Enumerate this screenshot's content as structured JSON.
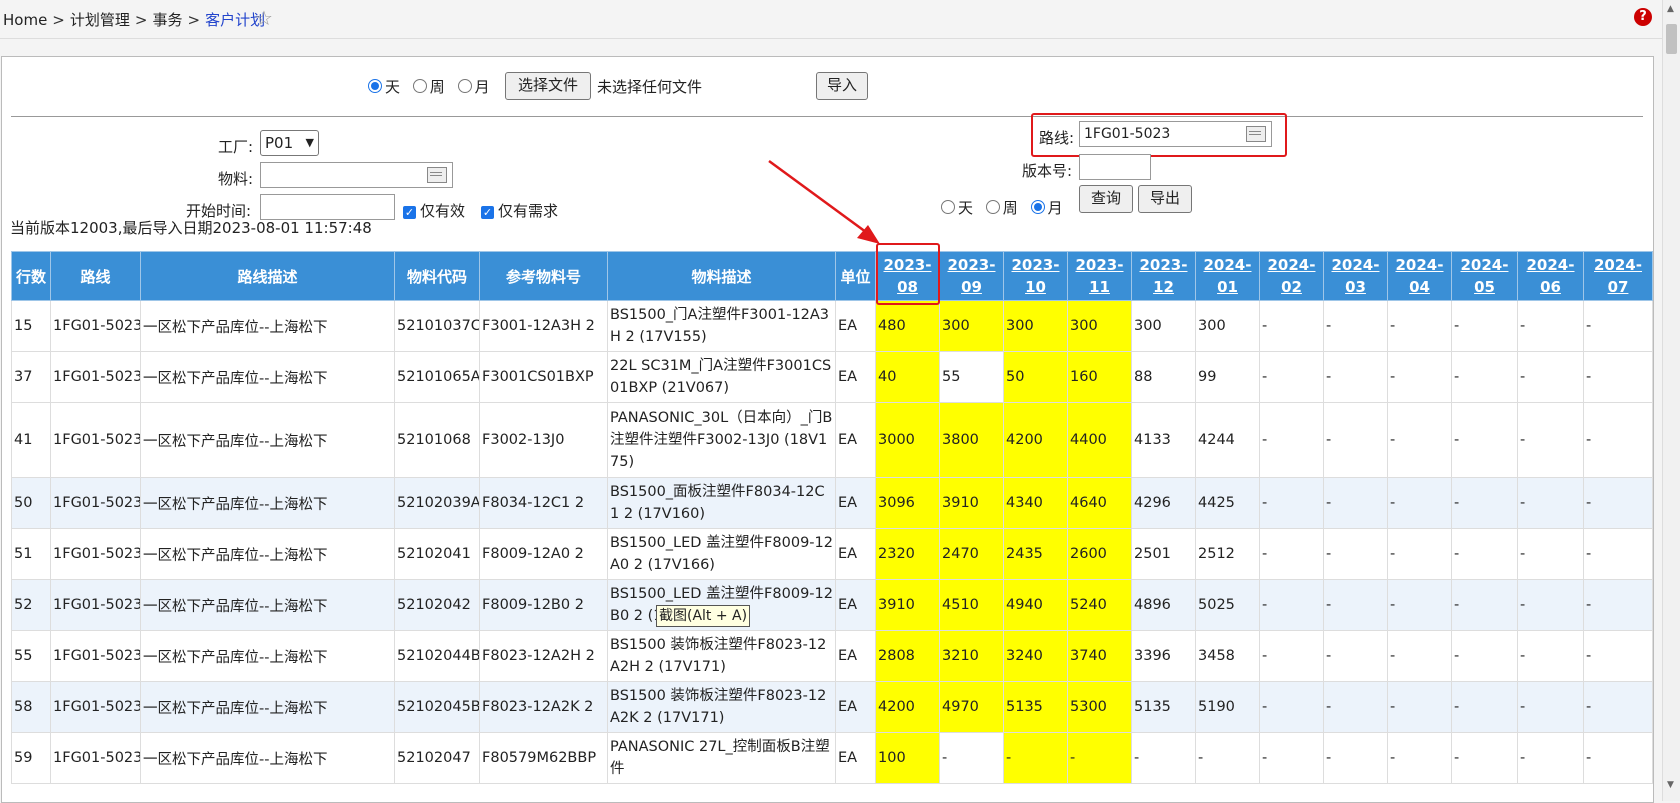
{
  "breadcrumb": {
    "home": "Home",
    "sep": ">",
    "level1": "计划管理",
    "level2": "事务",
    "current": "客户计划"
  },
  "import_bar": {
    "radios": [
      {
        "label": "天",
        "checked": true
      },
      {
        "label": "周",
        "checked": false
      },
      {
        "label": "月",
        "checked": false
      }
    ],
    "choose_file": "选择文件",
    "no_file": "未选择任何文件",
    "import": "导入"
  },
  "filters": {
    "factory_label": "工厂:",
    "factory_value": "P01",
    "material_label": "物料:",
    "material_value": "",
    "start_label": "开始时间:",
    "start_value": "",
    "valid_only": "仅有效",
    "demand_only": "仅有需求",
    "route_label": "路线:",
    "route_value": "1FG01-5023",
    "version_label": "版本号:",
    "version_value": "",
    "period_radios": [
      {
        "label": "天",
        "checked": false
      },
      {
        "label": "周",
        "checked": false
      },
      {
        "label": "月",
        "checked": true
      }
    ],
    "query": "查询",
    "export": "导出"
  },
  "status": "当前版本12003,最后导入日期2023-08-01 11:57:48",
  "table": {
    "headers": [
      "行数",
      "路线",
      "路线描述",
      "物料代码",
      "参考物料号",
      "物料描述",
      "单位"
    ],
    "months": [
      [
        "2023-",
        "08"
      ],
      [
        "2023-",
        "09"
      ],
      [
        "2023-",
        "10"
      ],
      [
        "2023-",
        "11"
      ],
      [
        "2023-",
        "12"
      ],
      [
        "2024-",
        "01"
      ],
      [
        "2024-",
        "02"
      ],
      [
        "2024-",
        "03"
      ],
      [
        "2024-",
        "04"
      ],
      [
        "2024-",
        "05"
      ],
      [
        "2024-",
        "06"
      ],
      [
        "2024-07",
        ""
      ]
    ],
    "rows": [
      {
        "n": "15",
        "route": "1FG01-5023",
        "route_desc": "一区松下产品库位--上海松下",
        "code": "52101037C",
        "ref": "F3001-12A3H 2",
        "desc": "BS1500_门A注塑件F3001-12A3H 2 (17V155)",
        "unit": "EA",
        "vals": [
          "480",
          "300",
          "300",
          "300",
          "300",
          "300",
          "-",
          "-",
          "-",
          "-",
          "-",
          "-"
        ]
      },
      {
        "n": "37",
        "route": "1FG01-5023",
        "route_desc": "一区松下产品库位--上海松下",
        "code": "52101065A",
        "ref": "F3001CS01BXP",
        "desc": "22L SC31M_门A注塑件F3001CS01BXP (21V067)",
        "unit": "EA",
        "vals": [
          "40",
          "55",
          "50",
          "160",
          "88",
          "99",
          "-",
          "-",
          "-",
          "-",
          "-",
          "-"
        ]
      },
      {
        "n": "41",
        "route": "1FG01-5023",
        "route_desc": "一区松下产品库位--上海松下",
        "code": "52101068",
        "ref": "F3002-13J0",
        "desc": "PANASONIC_30L（日本向）_门B注塑件注塑件F3002-13J0 (18V175)",
        "unit": "EA",
        "vals": [
          "3000",
          "3800",
          "4200",
          "4400",
          "4133",
          "4244",
          "-",
          "-",
          "-",
          "-",
          "-",
          "-"
        ]
      },
      {
        "n": "50",
        "route": "1FG01-5023",
        "route_desc": "一区松下产品库位--上海松下",
        "code": "52102039A",
        "ref": "F8034-12C1  2",
        "desc": "BS1500_面板注塑件F8034-12C1  2 (17V160)",
        "unit": "EA",
        "vals": [
          "3096",
          "3910",
          "4340",
          "4640",
          "4296",
          "4425",
          "-",
          "-",
          "-",
          "-",
          "-",
          "-"
        ]
      },
      {
        "n": "51",
        "route": "1FG01-5023",
        "route_desc": "一区松下产品库位--上海松下",
        "code": "52102041",
        "ref": "F8009-12A0  2",
        "desc": "BS1500_LED 盖注塑件F8009-12A0  2 (17V166)",
        "unit": "EA",
        "vals": [
          "2320",
          "2470",
          "2435",
          "2600",
          "2501",
          "2512",
          "-",
          "-",
          "-",
          "-",
          "-",
          "-"
        ]
      },
      {
        "n": "52",
        "route": "1FG01-5023",
        "route_desc": "一区松下产品库位--上海松下",
        "code": "52102042",
        "ref": "F8009-12B0  2",
        "desc": "BS1500_LED 盖注塑件F8009-12B0  2 (17V167)",
        "unit": "EA",
        "vals": [
          "3910",
          "4510",
          "4940",
          "5240",
          "4896",
          "5025",
          "-",
          "-",
          "-",
          "-",
          "-",
          "-"
        ]
      },
      {
        "n": "55",
        "route": "1FG01-5023",
        "route_desc": "一区松下产品库位--上海松下",
        "code": "52102044B",
        "ref": "F8023-12A2H 2",
        "desc": "BS1500 装饰板注塑件F8023-12A2H 2 (17V171)",
        "unit": "EA",
        "vals": [
          "2808",
          "3210",
          "3240",
          "3740",
          "3396",
          "3458",
          "-",
          "-",
          "-",
          "-",
          "-",
          "-"
        ]
      },
      {
        "n": "58",
        "route": "1FG01-5023",
        "route_desc": "一区松下产品库位--上海松下",
        "code": "52102045B",
        "ref": "F8023-12A2K 2",
        "desc": "BS1500 装饰板注塑件F8023-12A2K 2 (17V171)",
        "unit": "EA",
        "vals": [
          "4200",
          "4970",
          "5135",
          "5300",
          "5135",
          "5190",
          "-",
          "-",
          "-",
          "-",
          "-",
          "-"
        ]
      },
      {
        "n": "59",
        "route": "1FG01-5023",
        "route_desc": "一区松下产品库位--上海松下",
        "code": "52102047",
        "ref": "F80579M62BBP",
        "desc": "PANASONIC 27L_控制面板B注塑件",
        "unit": "EA",
        "vals": [
          "100",
          "-",
          "-",
          "-",
          "-",
          "-",
          "-",
          "-",
          "-",
          "-",
          "-",
          "-"
        ]
      }
    ]
  },
  "tooltip": "截图(Alt + A)"
}
